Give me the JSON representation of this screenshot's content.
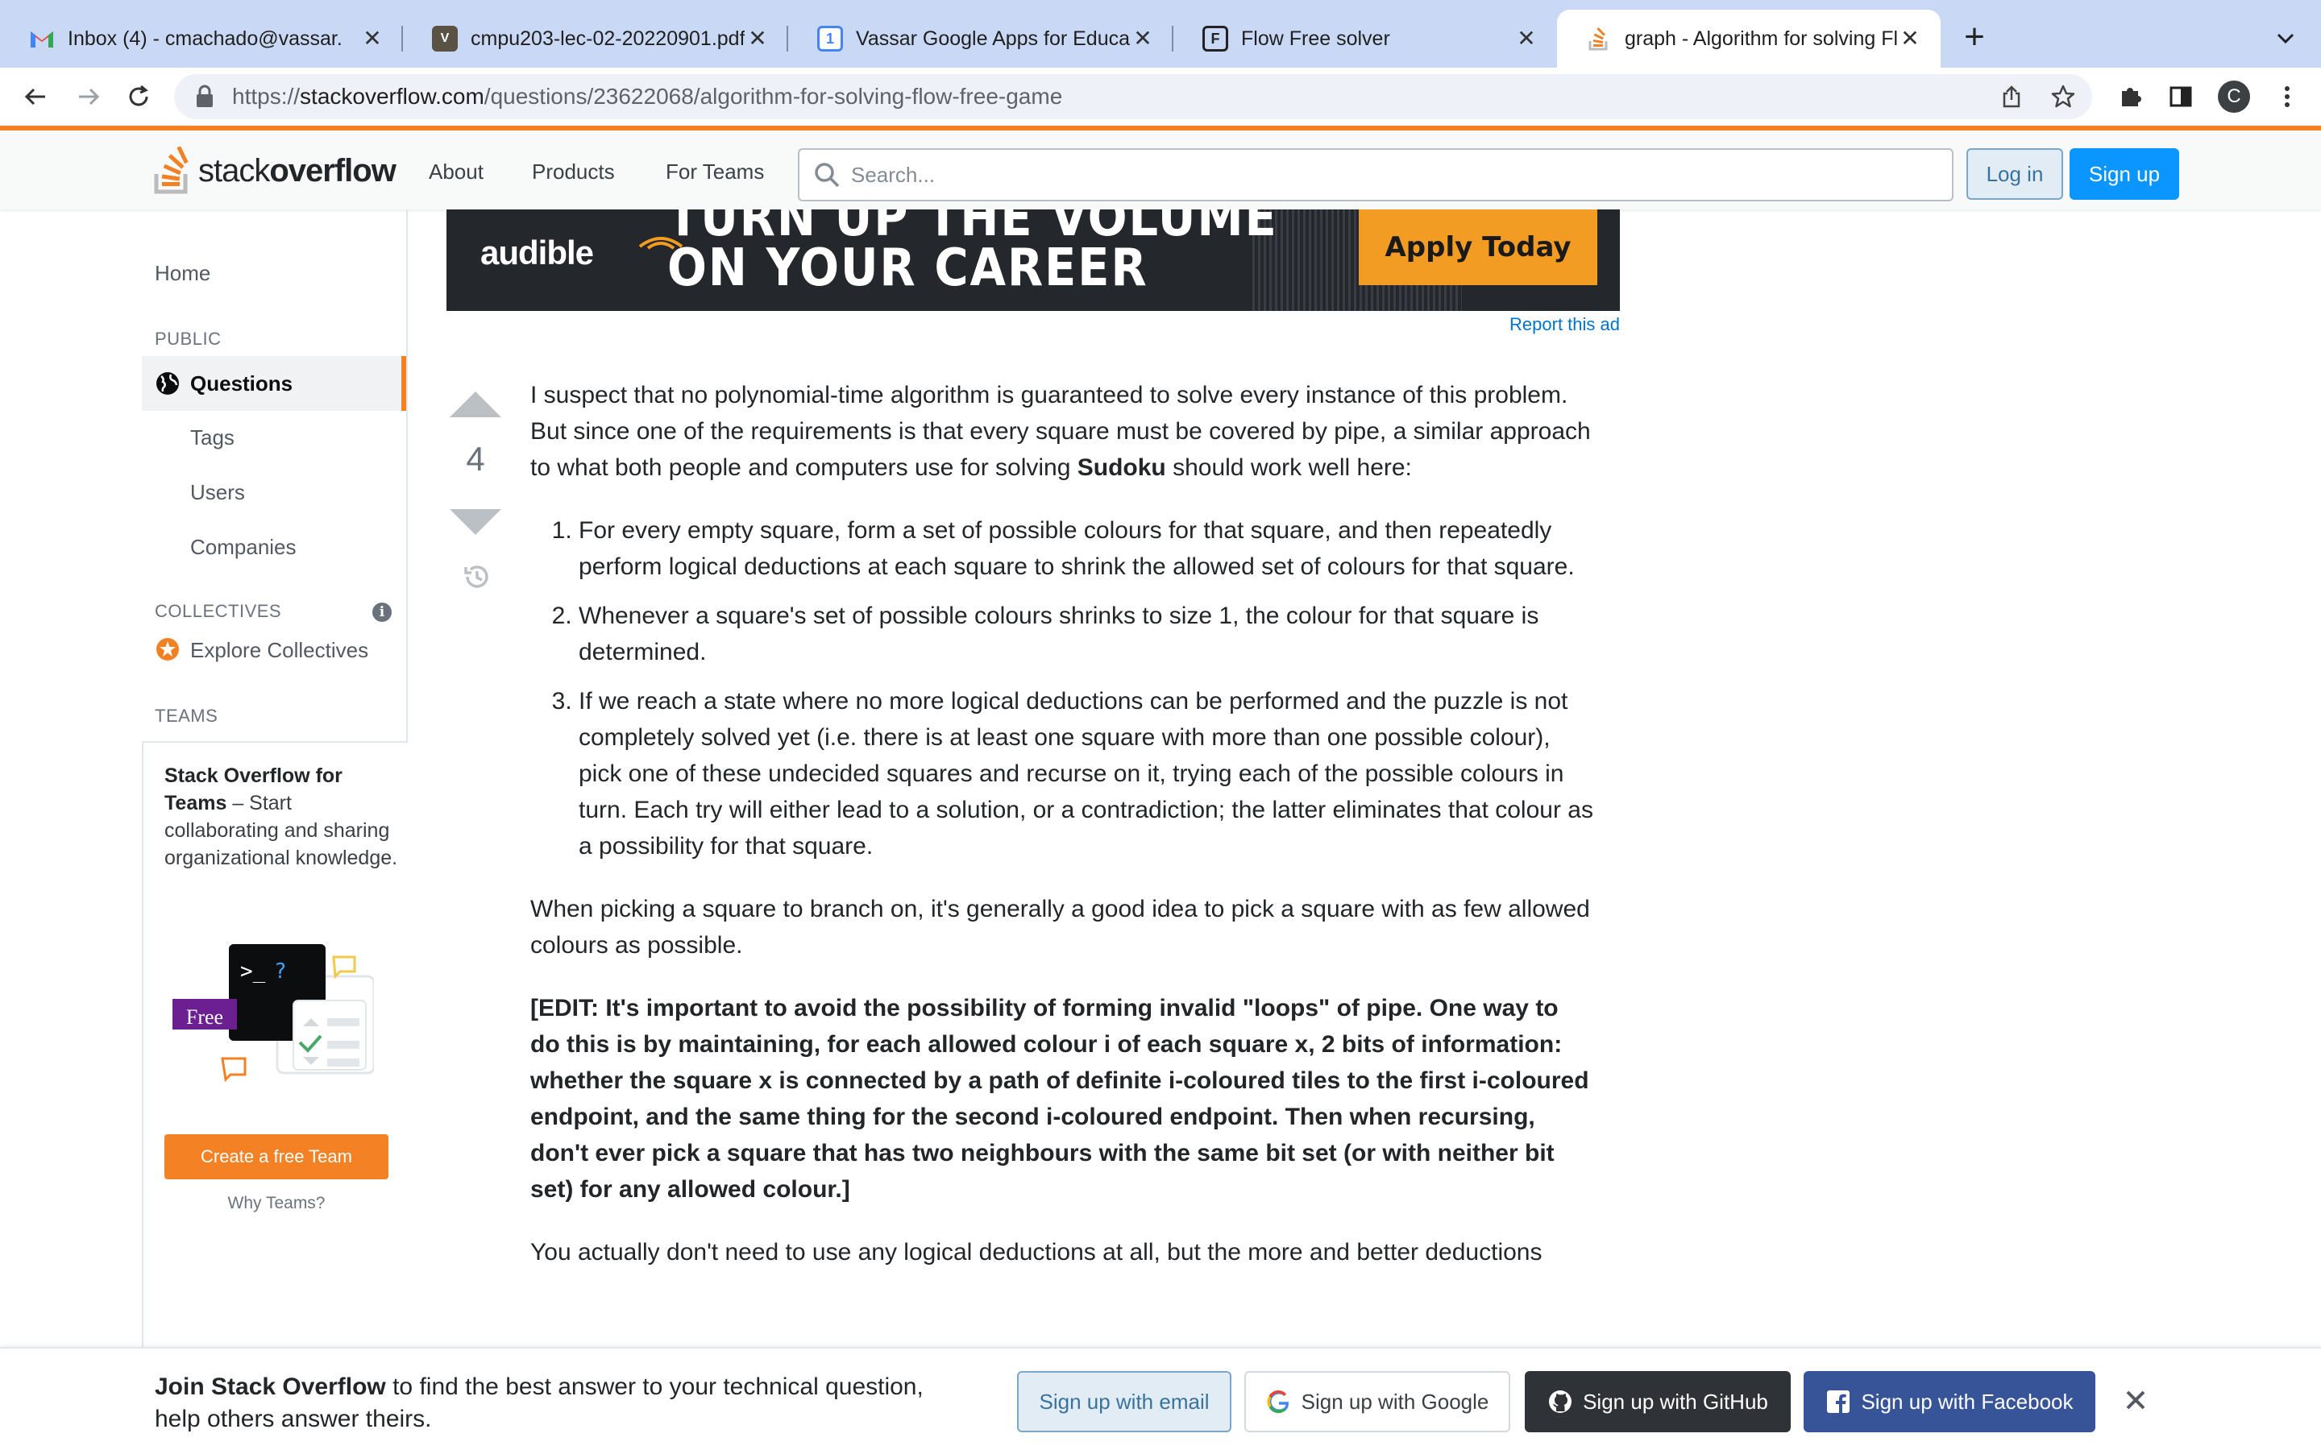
{
  "browser": {
    "tabs": [
      {
        "title": "Inbox (4) - cmachado@vassar.",
        "icon": "gmail-icon"
      },
      {
        "title": "cmpu203-lec-02-20220901.pdf",
        "icon": "pdf-viewer-icon"
      },
      {
        "title": "Vassar Google Apps for Educat",
        "icon": "google-calendar-icon"
      },
      {
        "title": "Flow Free solver",
        "icon": "flow-free-icon"
      },
      {
        "title": "graph - Algorithm for solving Fl",
        "icon": "stackoverflow-icon"
      }
    ],
    "url_base": "https://",
    "url_domain": "stackoverflow.com",
    "url_path": "/questions/23622068/algorithm-for-solving-flow-free-game",
    "profile_initial": "C"
  },
  "so": {
    "logo_light": "stack",
    "logo_bold": "overflow",
    "nav": {
      "about": "About",
      "products": "Products",
      "for_teams": "For Teams"
    },
    "search_placeholder": "Search...",
    "login": "Log in",
    "signup": "Sign up",
    "accent": "#f48024",
    "primary_blue": "#0a95ff"
  },
  "sidebar": {
    "home": "Home",
    "public_heading": "PUBLIC",
    "questions": "Questions",
    "tags": "Tags",
    "users": "Users",
    "companies": "Companies",
    "collectives_heading": "COLLECTIVES",
    "explore_collectives": "Explore Collectives",
    "teams_heading": "TEAMS",
    "teams_title": "Stack Overflow for Teams",
    "teams_desc": "– Start collaborating and sharing organizational knowledge.",
    "illus_badge": "Free",
    "illus_prompt": ">_?",
    "create_team": "Create a free Team",
    "why_teams": "Why Teams?"
  },
  "ad": {
    "brand": "audible",
    "line1": "TURN UP THE VOLUME",
    "line2": "ON YOUR CAREER",
    "cta": "Apply Today",
    "report": "Report this ad"
  },
  "answer": {
    "votes": "4",
    "p1_a": "I suspect that no polynomial-time algorithm is guaranteed to solve every instance of this problem. But since one of the requirements is that every square must be covered by pipe, a similar approach to what both people and computers use for solving ",
    "p1_bold": "Sudoku",
    "p1_b": " should work well here:",
    "steps": [
      "For every empty square, form a set of possible colours for that square, and then repeatedly perform logical deductions at each square to shrink the allowed set of colours for that square.",
      "Whenever a square's set of possible colours shrinks to size 1, the colour for that square is determined.",
      "If we reach a state where no more logical deductions can be performed and the puzzle is not completely solved yet (i.e. there is at least one square with more than one possible colour), pick one of these undecided squares and recurse on it, trying each of the possible colours in turn. Each try will either lead to a solution, or a contradiction; the latter eliminates that colour as a possibility for that square."
    ],
    "p2": "When picking a square to branch on, it's generally a good idea to pick a square with as few allowed colours as possible.",
    "p3": "[EDIT: It's important to avoid the possibility of forming invalid \"loops\" of pipe. One way to do this is by maintaining, for each allowed colour i of each square x, 2 bits of information: whether the square x is connected by a path of definite i-coloured tiles to the first i-coloured endpoint, and the same thing for the second i-coloured endpoint. Then when recursing, don't ever pick a square that has two neighbours with the same bit set (or with neither bit set) for any allowed colour.]",
    "p4": "You actually don't need to use any logical deductions at all, but the more and better deductions"
  },
  "banner": {
    "text_bold": "Join Stack Overflow",
    "text_rest": " to find the best answer to your technical question, help others answer theirs.",
    "email": "Sign up with email",
    "google": "Sign up with Google",
    "github": "Sign up with GitHub",
    "facebook": "Sign up with Facebook"
  }
}
